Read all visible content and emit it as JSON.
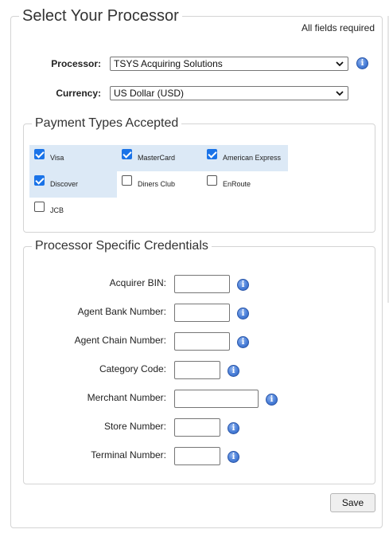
{
  "form": {
    "title": "Select Your Processor",
    "required_note": "All fields required",
    "processor_label": "Processor:",
    "processor_value": "TSYS Acquiring Solutions",
    "currency_label": "Currency:",
    "currency_value": "US Dollar (USD)",
    "info_glyph": "i"
  },
  "payment_types": {
    "legend": "Payment Types Accepted",
    "items": [
      {
        "label": "Visa",
        "checked": true
      },
      {
        "label": "MasterCard",
        "checked": true
      },
      {
        "label": "American Express",
        "checked": true
      },
      {
        "label": "Discover",
        "checked": true
      },
      {
        "label": "Diners Club",
        "checked": false
      },
      {
        "label": "EnRoute",
        "checked": false
      },
      {
        "label": "JCB",
        "checked": false
      }
    ]
  },
  "credentials": {
    "legend": "Processor Specific Credentials",
    "fields": [
      {
        "label": "Acquirer BIN:",
        "value": ""
      },
      {
        "label": "Agent Bank Number:",
        "value": ""
      },
      {
        "label": "Agent Chain Number:",
        "value": ""
      },
      {
        "label": "Category Code:",
        "value": ""
      },
      {
        "label": "Merchant Number:",
        "value": ""
      },
      {
        "label": "Store Number:",
        "value": ""
      },
      {
        "label": "Terminal Number:",
        "value": ""
      }
    ]
  },
  "actions": {
    "save_label": "Save"
  },
  "colors": {
    "accent": "#1a73e8",
    "checked_bg": "#dce9f6",
    "info_icon": "#4a7fd8"
  }
}
